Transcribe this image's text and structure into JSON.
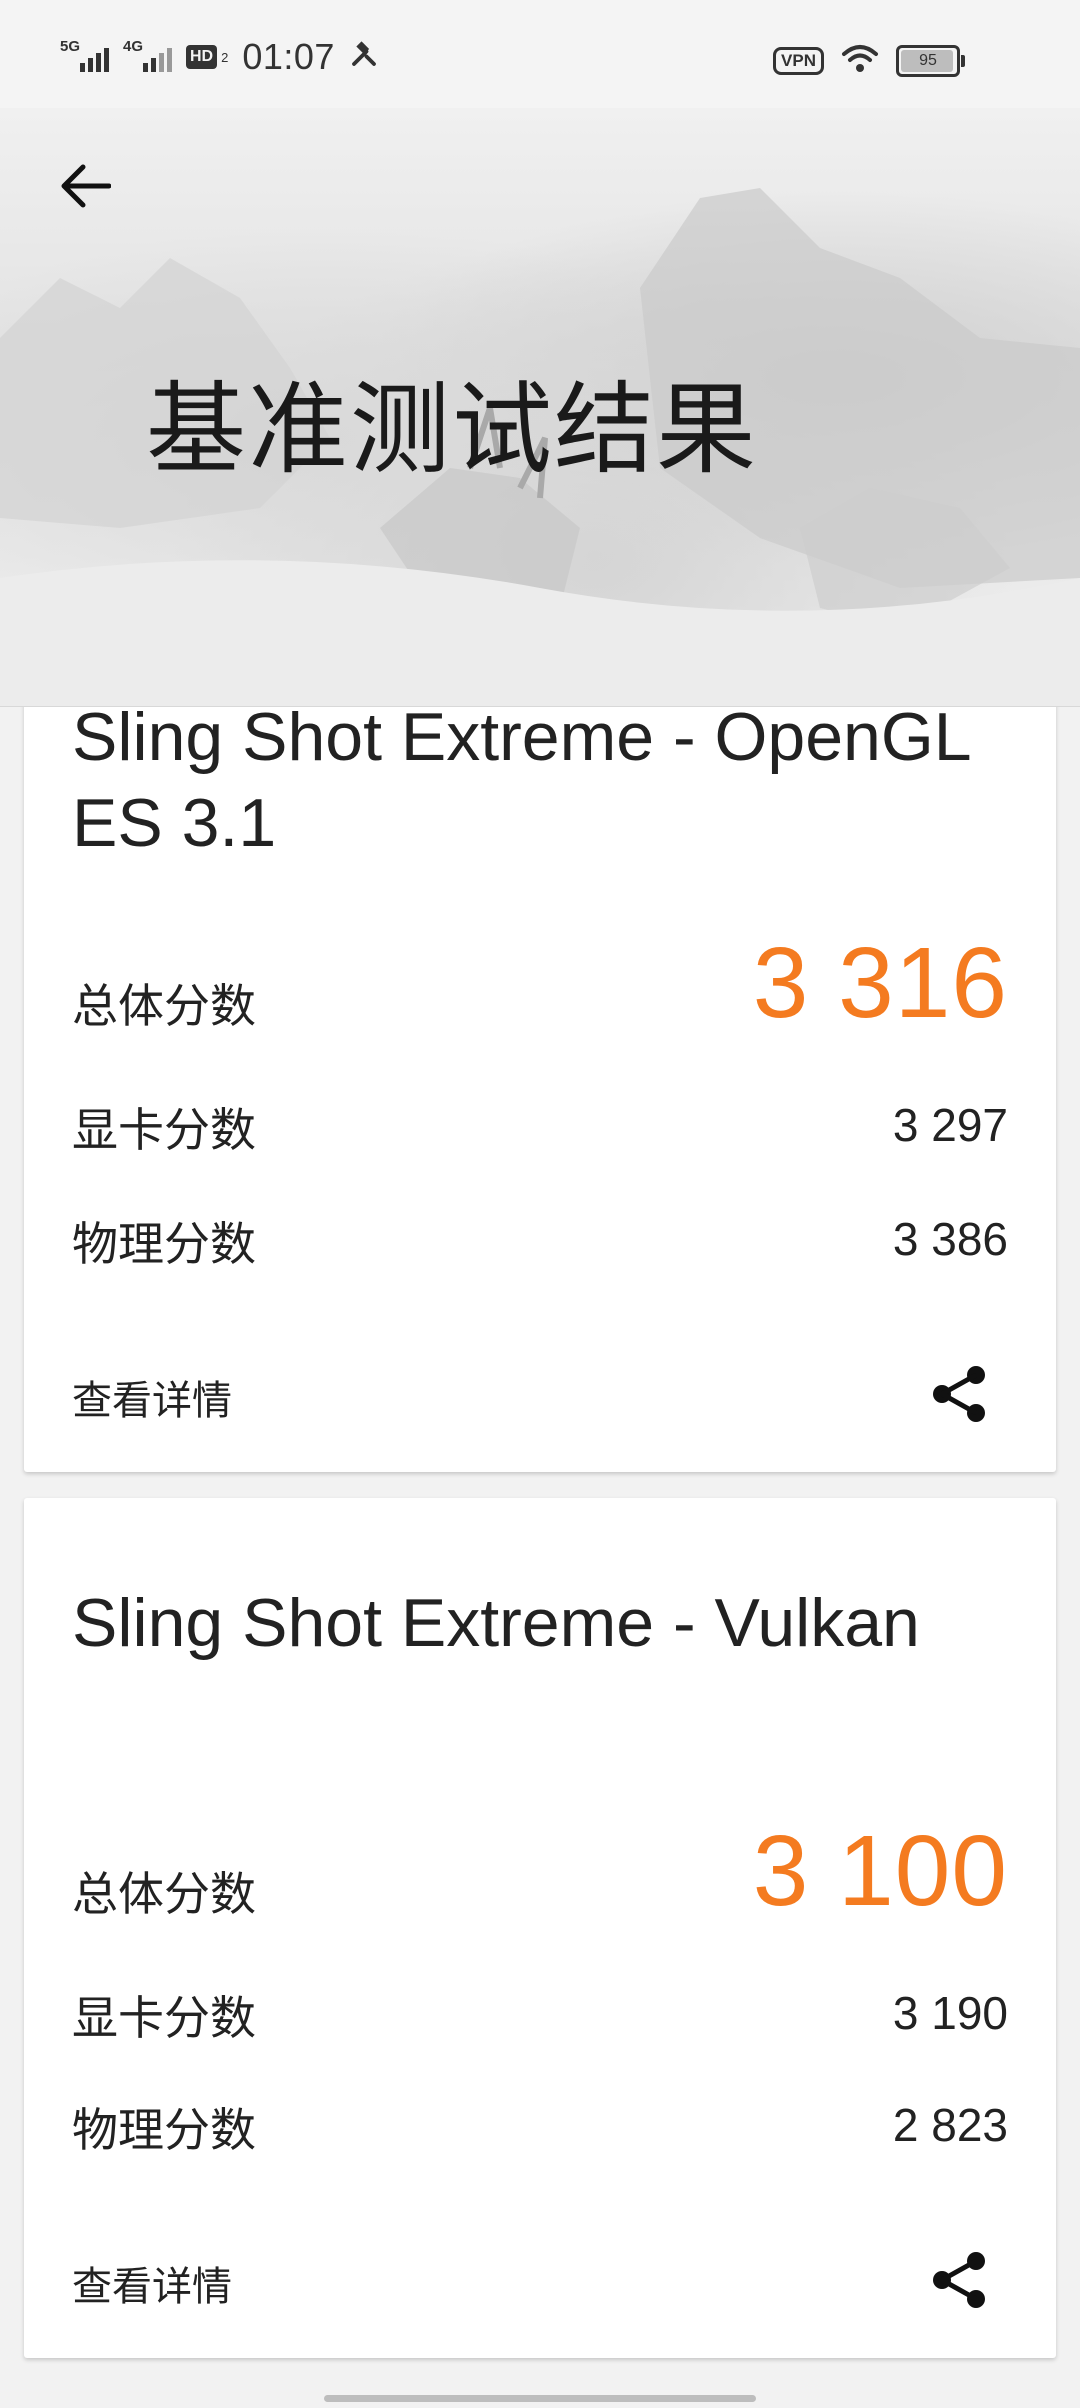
{
  "status_bar": {
    "network1": "5G",
    "network2": "4G",
    "hd_badge": "HD",
    "hd_sub": "2",
    "time": "01:07",
    "vpn": "VPN",
    "battery": "95",
    "icons": [
      "signal-5g-icon",
      "signal-4g-icon",
      "hd-voice-icon",
      "tools-icon",
      "vpn-icon",
      "wifi-icon",
      "battery-icon"
    ]
  },
  "header": {
    "title": "基准测试结果",
    "back_icon": "arrow-left-icon"
  },
  "results": [
    {
      "title": "Sling Shot Extreme - OpenGL ES 3.1",
      "overall_label": "总体分数",
      "overall_score": "3 316",
      "graphics_label": "显卡分数",
      "graphics_score": "3 297",
      "physics_label": "物理分数",
      "physics_score": "3 386",
      "details_label": "查看详情",
      "share_icon": "share-icon"
    },
    {
      "title": "Sling Shot Extreme - Vulkan",
      "overall_label": "总体分数",
      "overall_score": "3 100",
      "graphics_label": "显卡分数",
      "graphics_score": "3 190",
      "physics_label": "物理分数",
      "physics_score": "2 823",
      "details_label": "查看详情",
      "share_icon": "share-icon"
    }
  ],
  "colors": {
    "accent": "#f47b20",
    "background": "#f2f2f2",
    "card": "#ffffff"
  }
}
